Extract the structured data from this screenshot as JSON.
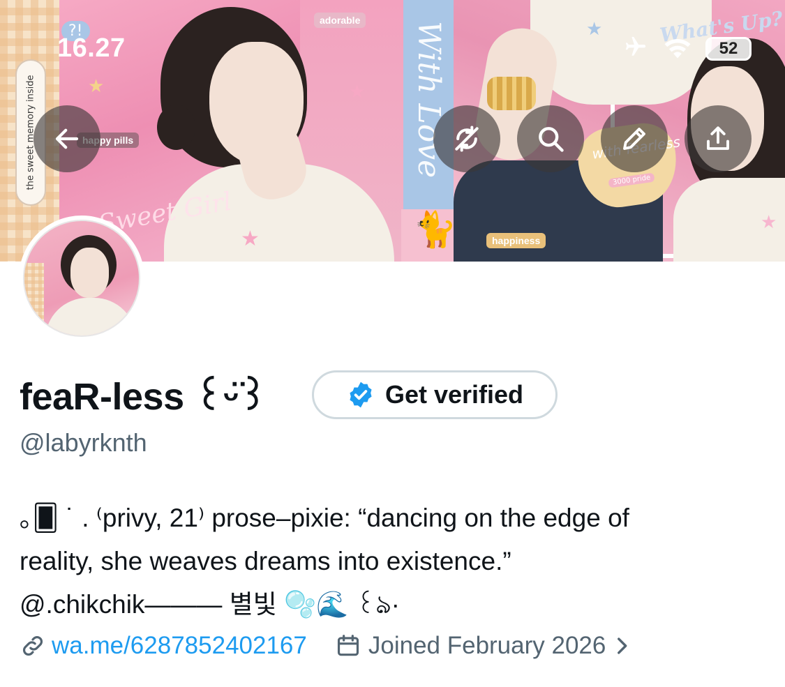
{
  "status_bar": {
    "time": "16.27",
    "battery": "52"
  },
  "banner": {
    "stickers": {
      "side_tag": "the sweet memory inside",
      "adorable": "adorable",
      "happy_pills": "happy pills",
      "with_love": "With Love",
      "sweet_girl": "Sweet Girl",
      "happiness": "happiness",
      "whats_up": "What's Up?",
      "heart_tag": "with fearless",
      "heart_tag_sub": "3000 pride",
      "question": "?!"
    }
  },
  "profile": {
    "display_name": "feaR-less ꒰ᵕ̈꒱",
    "verify_label": "Get verified",
    "handle": "@labyrknth",
    "bio_lines": [
      "｡🂠 ˙ . ⁽privy, 21⁾  prose–pixie: “dancing on the edge of",
      "reality, she weaves dreams into existence.”",
      "@.chikchik——— 별빛 🫧🌊 ꒰ঌ·"
    ],
    "link": "wa.me/6287852402167",
    "joined": "Joined February 2026"
  },
  "colors": {
    "link_blue": "#1d9bf0",
    "secondary_text": "#536471",
    "verified_badge": "#1d9bf0"
  },
  "icons": [
    "back-arrow-icon",
    "sync-off-icon",
    "search-icon",
    "edit-pencil-icon",
    "share-icon",
    "verified-badge-icon",
    "link-icon",
    "calendar-icon",
    "chevron-right-icon",
    "airplane-icon",
    "wifi-icon",
    "battery-icon"
  ]
}
